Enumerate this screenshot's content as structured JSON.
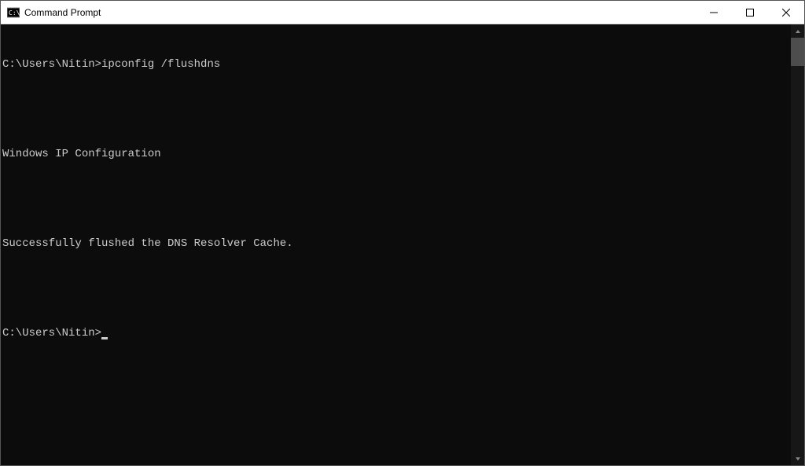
{
  "window": {
    "title": "Command Prompt"
  },
  "terminal": {
    "line1_prompt": "C:\\Users\\Nitin>",
    "line1_cmd": "ipconfig /flushdns",
    "blank1": "",
    "line2": "Windows IP Configuration",
    "blank2": "",
    "line3": "Successfully flushed the DNS Resolver Cache.",
    "blank3": "",
    "line4_prompt": "C:\\Users\\Nitin>"
  }
}
